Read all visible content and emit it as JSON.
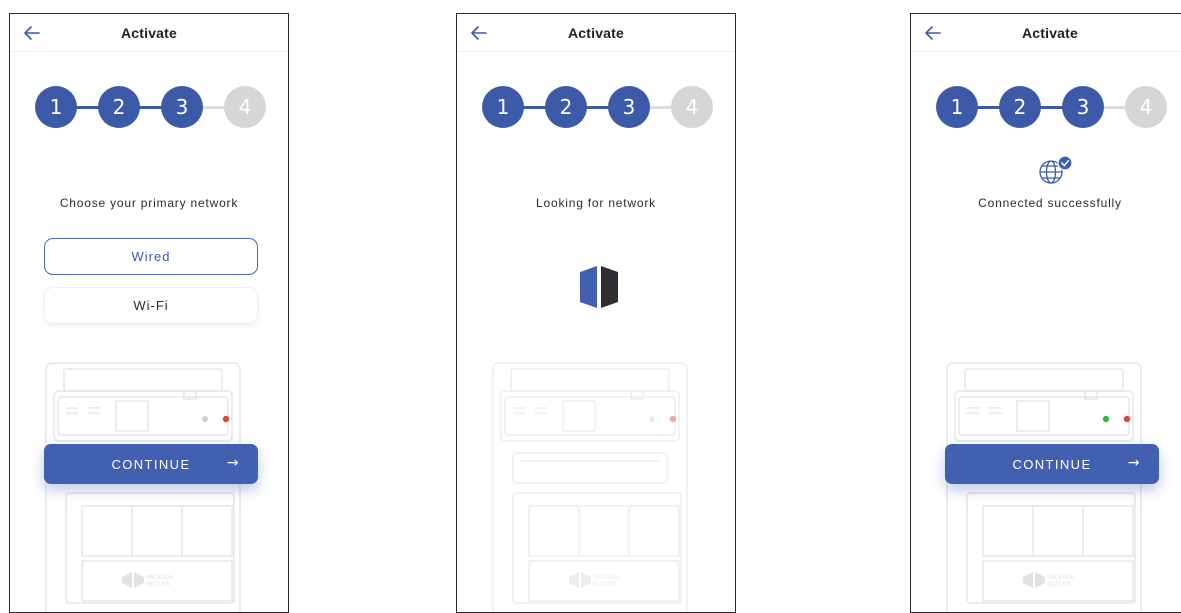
{
  "colors": {
    "primary": "#4161b0",
    "step_inactive": "#d6d6d8",
    "step_line_active": "#3d5aa8",
    "step_line_inactive": "#dcdce0",
    "led_red": "#e0463c",
    "led_grey": "#cfcfd4",
    "led_green": "#3bb54a"
  },
  "screens": [
    {
      "title": "Activate",
      "steps": [
        "1",
        "2",
        "3",
        "4"
      ],
      "active_step_count": 3,
      "prompt": "Choose your primary network",
      "options": [
        {
          "label": "Wired",
          "selected": true
        },
        {
          "label": "Wi-Fi",
          "selected": false
        }
      ],
      "continue_label": "CONTINUE",
      "continue_arrow": "→",
      "device_brand": [
        "PACKAGE",
        "BUTLER"
      ],
      "leds": [
        "grey",
        "red"
      ]
    },
    {
      "title": "Activate",
      "steps": [
        "1",
        "2",
        "3",
        "4"
      ],
      "active_step_count": 3,
      "prompt": "Looking for network",
      "loader_icon": "cube-loader-icon",
      "device_brand": [
        "PACKAGE",
        "BUTLER"
      ],
      "leds": [
        "grey",
        "red"
      ]
    },
    {
      "title": "Activate",
      "steps": [
        "1",
        "2",
        "3",
        "4"
      ],
      "active_step_count": 3,
      "prompt": "Connected successfully",
      "status_icon": "globe-check-icon",
      "continue_label": "CONTINUE",
      "continue_arrow": "→",
      "device_brand": [
        "PACKAGE",
        "BUTLER"
      ],
      "leds": [
        "green",
        "red"
      ]
    }
  ]
}
